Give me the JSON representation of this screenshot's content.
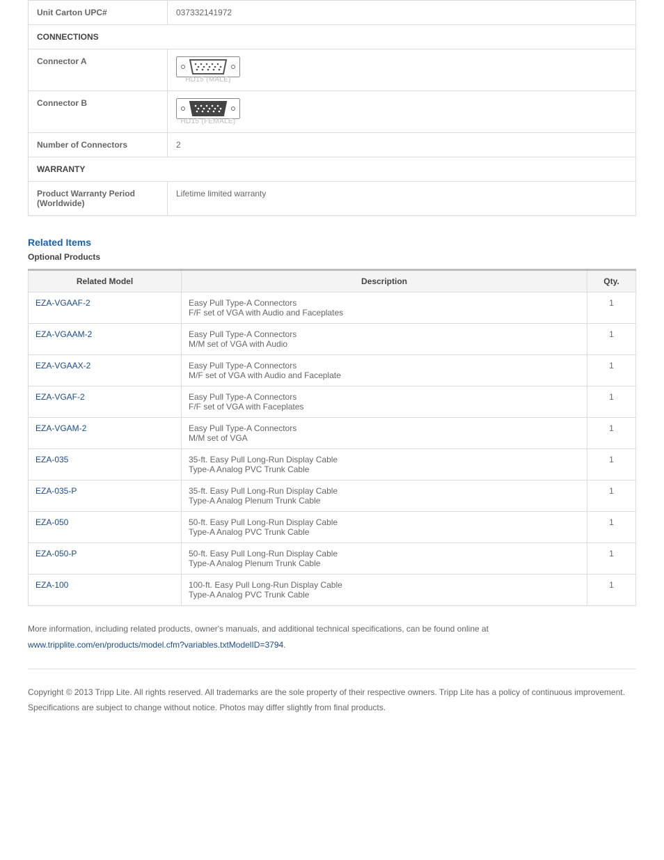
{
  "spec": {
    "upc_label": "Unit Carton UPC#",
    "upc_value": "037332141972",
    "connections_header": "CONNECTIONS",
    "connector_a_label": "Connector A",
    "connector_a_caption": "HD15 (MALE)",
    "connector_b_label": "Connector B",
    "connector_b_caption": "HD15 (FEMALE)",
    "num_connectors_label": "Number of Connectors",
    "num_connectors_value": "2",
    "warranty_header": "WARRANTY",
    "warranty_label": "Product Warranty Period (Worldwide)",
    "warranty_value": "Lifetime limited warranty"
  },
  "related": {
    "heading": "Related Items",
    "subheading": "Optional Products",
    "columns": {
      "model": "Related Model",
      "description": "Description",
      "qty": "Qty."
    },
    "items": [
      {
        "model": "EZA-VGAAF-2",
        "desc1": "Easy Pull Type-A Connectors",
        "desc2": "F/F set of VGA with Audio and Faceplates",
        "qty": "1"
      },
      {
        "model": "EZA-VGAAM-2",
        "desc1": "Easy Pull Type-A Connectors",
        "desc2": "M/M set of VGA with Audio",
        "qty": "1"
      },
      {
        "model": "EZA-VGAAX-2",
        "desc1": "Easy Pull Type-A Connectors",
        "desc2": "M/F set of VGA with Audio and Faceplate",
        "qty": "1"
      },
      {
        "model": "EZA-VGAF-2",
        "desc1": "Easy Pull Type-A Connectors",
        "desc2": "F/F set of VGA with Faceplates",
        "qty": "1"
      },
      {
        "model": "EZA-VGAM-2",
        "desc1": "Easy Pull Type-A Connectors",
        "desc2": "M/M set of VGA",
        "qty": "1"
      },
      {
        "model": "EZA-035",
        "desc1": "35-ft. Easy Pull Long-Run Display Cable",
        "desc2": "Type-A Analog PVC Trunk Cable",
        "qty": "1"
      },
      {
        "model": "EZA-035-P",
        "desc1": "35-ft. Easy Pull Long-Run Display Cable",
        "desc2": "Type-A Analog Plenum Trunk Cable",
        "qty": "1"
      },
      {
        "model": "EZA-050",
        "desc1": "50-ft. Easy Pull Long-Run Display Cable",
        "desc2": "Type-A Analog PVC Trunk Cable",
        "qty": "1"
      },
      {
        "model": "EZA-050-P",
        "desc1": "50-ft. Easy Pull Long-Run Display Cable",
        "desc2": "Type-A Analog Plenum Trunk Cable",
        "qty": "1"
      },
      {
        "model": "EZA-100",
        "desc1": "100-ft. Easy Pull Long-Run Display Cable",
        "desc2": "Type-A Analog PVC Trunk Cable",
        "qty": "1"
      }
    ]
  },
  "footer": {
    "more_info_prefix": "More information, including related products, owner's manuals, and additional technical specifications, can be found online at ",
    "more_info_link": "www.tripplite.com/en/products/model.cfm?variables.txtModelID=3794",
    "more_info_suffix": ".",
    "copyright": "Copyright © 2013 Tripp Lite. All rights reserved. All trademarks are the sole property of their respective owners. Tripp Lite has a policy of continuous improvement. Specifications are subject to change without notice. Photos may differ slightly from final products."
  }
}
